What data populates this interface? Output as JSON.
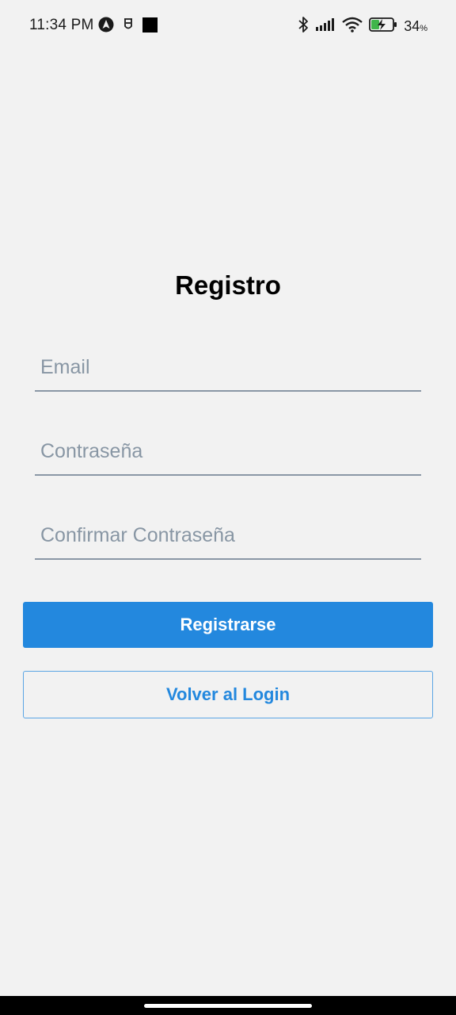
{
  "status_bar": {
    "time": "11:34 PM",
    "battery_percent": "34",
    "battery_unit": "%",
    "icons": [
      "navigation-app-icon",
      "shield-app-icon",
      "black-square-icon",
      "bluetooth-icon",
      "cell-signal-icon",
      "wifi-icon",
      "battery-charging-icon"
    ]
  },
  "screen": {
    "title": "Registro"
  },
  "form": {
    "email_placeholder": "Email",
    "email_value": "",
    "password_placeholder": "Contraseña",
    "password_value": "",
    "confirm_placeholder": "Confirmar Contraseña",
    "confirm_value": ""
  },
  "buttons": {
    "register_label": "Registrarse",
    "back_label": "Volver al Login"
  },
  "colors": {
    "background": "#f2f2f2",
    "primary": "#2388de",
    "input_underline": "#8a97a6",
    "placeholder": "#8896a4"
  }
}
